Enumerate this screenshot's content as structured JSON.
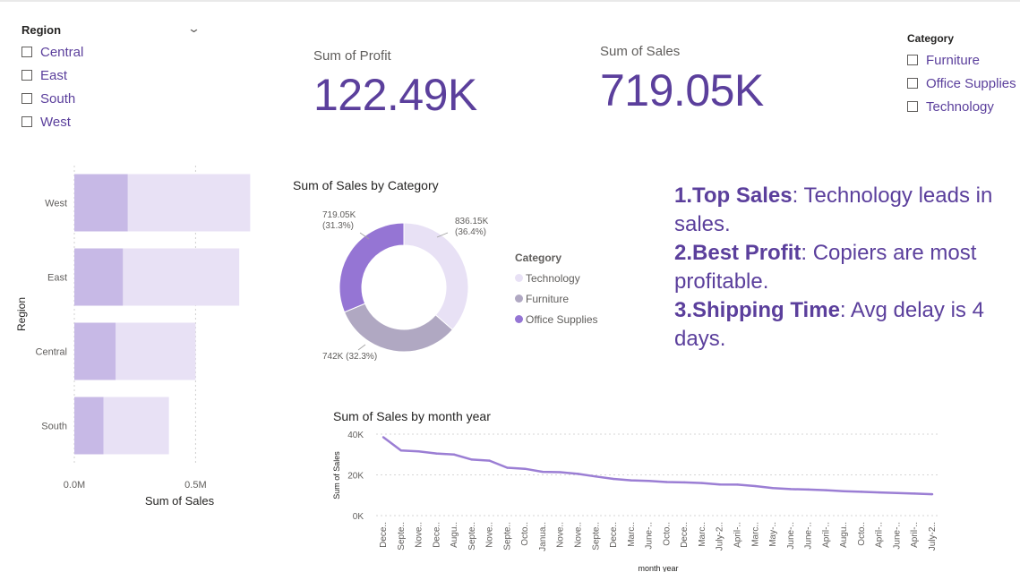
{
  "colors": {
    "accent": "#5b3f9c",
    "bar_light": "#e8e1f5",
    "bar_dark": "#c7b9e6",
    "line": "#9b7ed4",
    "technology": "#e8e1f5",
    "furniture": "#b0a8c2",
    "office_supplies": "#9575d4"
  },
  "region_slicer": {
    "title": "Region",
    "items": [
      "Central",
      "East",
      "South",
      "West"
    ]
  },
  "category_slicer": {
    "title": "Category",
    "items": [
      "Furniture",
      "Office Supplies",
      "Technology"
    ]
  },
  "cards": {
    "profit": {
      "label": "Sum of Profit",
      "value": "122.49K"
    },
    "sales": {
      "label": "Sum of Sales",
      "value": "719.05K"
    }
  },
  "insights": [
    {
      "title": "1.Top Sales",
      "text": ": Technology leads in sales."
    },
    {
      "title": "2.Best Profit",
      "text": ": Copiers are most profitable."
    },
    {
      "title": "3.Shipping Time",
      "text": ": Avg delay is 4 days."
    }
  ],
  "chart_data": [
    {
      "type": "bar",
      "orientation": "horizontal",
      "title": "",
      "xlabel": "Sum of Sales",
      "ylabel": "Region",
      "xlim": [
        0,
        0.72
      ],
      "x_ticks": [
        "0.0M",
        "0.5M"
      ],
      "x_tick_values": [
        0,
        0.5
      ],
      "categories": [
        "West",
        "East",
        "Central",
        "South"
      ],
      "series": [
        {
          "values": [
            0.725,
            0.68,
            0.5,
            0.39
          ]
        },
        {
          "values": [
            0.22,
            0.2,
            0.17,
            0.12
          ]
        }
      ]
    },
    {
      "type": "pie",
      "title": "Sum of Sales by Category",
      "legend_title": "Category",
      "legend_position": "right",
      "slices": [
        {
          "label": "Technology",
          "value": 836.15,
          "data_label": "836.15K\n(36.4%)"
        },
        {
          "label": "Furniture",
          "value": 742.0,
          "data_label": "742K (32.3%)"
        },
        {
          "label": "Office Supplies",
          "value": 719.05,
          "data_label": "719.05K\n(31.3%)"
        }
      ]
    },
    {
      "type": "line",
      "title": "Sum of Sales by month year",
      "xlabel": "month year",
      "ylabel": "Sum of Sales",
      "ylim": [
        0,
        40000
      ],
      "y_ticks": [
        "0K",
        "20K",
        "40K"
      ],
      "y_tick_values": [
        0,
        20000,
        40000
      ],
      "x": [
        "Dece..",
        "Septe..",
        "Nove..",
        "Dece..",
        "Augu..",
        "Septe..",
        "Nove..",
        "Septe..",
        "Octo..",
        "Janua..",
        "Nove..",
        "Nove..",
        "Septe..",
        "Dece..",
        "Marc..",
        "June-..",
        "Octo..",
        "Dece..",
        "Marc..",
        "July-2..",
        "April-..",
        "Marc..",
        "May-..",
        "June-..",
        "June-..",
        "April-..",
        "Augu..",
        "Octo..",
        "April-..",
        "June-..",
        "April-..",
        "July-2.."
      ],
      "values": [
        38500,
        32000,
        31500,
        30500,
        30000,
        27500,
        27000,
        23500,
        23000,
        21500,
        21300,
        20500,
        19200,
        18000,
        17300,
        17000,
        16500,
        16300,
        16000,
        15300,
        15200,
        14500,
        13500,
        13000,
        12800,
        12500,
        12000,
        11700,
        11400,
        11100,
        10800,
        10500
      ]
    }
  ]
}
